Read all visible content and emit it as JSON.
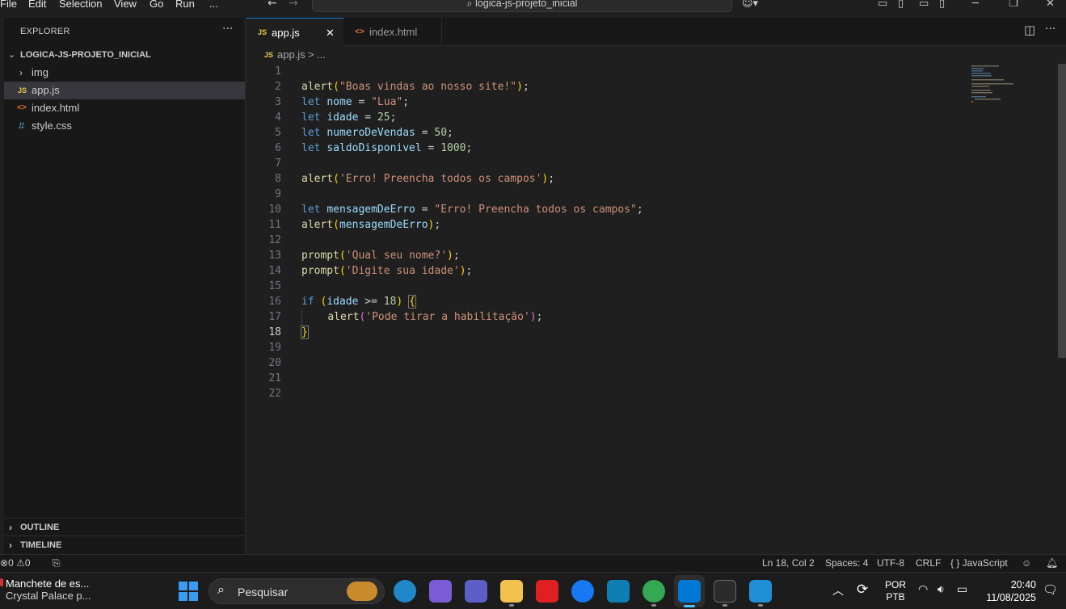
{
  "menu": [
    "File",
    "Edit",
    "Selection",
    "View",
    "Go",
    "Run",
    "..."
  ],
  "search": {
    "text": "logica-js-projeto_inicial"
  },
  "explorer": {
    "title": "EXPLORER",
    "folder": "LOGICA-JS-PROJETO_INICIAL",
    "items": [
      {
        "label": "img",
        "icon": "chevron-right-icon",
        "badge": ""
      },
      {
        "label": "app.js",
        "icon": "js-file-icon",
        "badge": "JS"
      },
      {
        "label": "index.html",
        "icon": "html-file-icon",
        "badge": "<>"
      },
      {
        "label": "style.css",
        "icon": "css-file-icon",
        "badge": "#"
      }
    ],
    "outline": "OUTLINE",
    "timeline": "TIMELINE"
  },
  "tabs": [
    {
      "label": "app.js",
      "badge": "JS",
      "active": true
    },
    {
      "label": "index.html",
      "badge": "<>",
      "active": false
    }
  ],
  "breadcrumb": {
    "badge": "JS",
    "file": "app.js",
    "sep": ">",
    "rest": "..."
  },
  "code": {
    "lines": [
      "1",
      "2",
      "3",
      "4",
      "5",
      "6",
      "7",
      "8",
      "9",
      "10",
      "11",
      "12",
      "13",
      "14",
      "15",
      "16",
      "17",
      "18",
      "19",
      "20",
      "21",
      "22"
    ],
    "current_line": "18"
  },
  "status": {
    "errors": "0",
    "warnings": "0",
    "position": "Ln 18, Col 2",
    "spaces": "Spaces: 4",
    "encoding": "UTF-8",
    "eol": "CRLF",
    "language": "{ } JavaScript"
  },
  "taskbar": {
    "news_title": "Manchete de es...",
    "news_sub": "Crystal Palace p...",
    "search_placeholder": "Pesquisar",
    "lang_top": "POR",
    "lang_bottom": "PTB",
    "time": "20:40",
    "date": "11/08/2025"
  },
  "colors": {
    "accent": "#0078d4",
    "editor_bg": "#1f1f1f",
    "sidebar_bg": "#181818",
    "keyword": "#569cd6",
    "string": "#ce9178",
    "function": "#dcdcaa",
    "number": "#b5cea8",
    "variable": "#9cdcfe"
  }
}
